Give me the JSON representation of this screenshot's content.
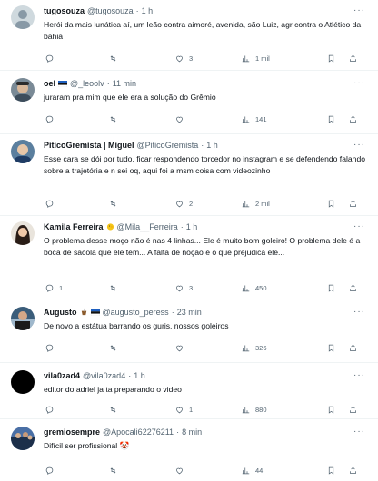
{
  "tweets": [
    {
      "name": "tugosouza",
      "handle": "@tugosouza",
      "time": "1 h",
      "text": "Herói da mais lunática aí, um leão contra aimoré, avenida, são Luiz, agr contra o Atlético da bahia",
      "replies": "",
      "retweets": "",
      "likes": "3",
      "views": "1 mil"
    },
    {
      "name": "oel",
      "handle": "@_leoolv",
      "time": "11 min",
      "text": "juraram pra mim que ele era a solução do Grêmio",
      "replies": "",
      "retweets": "",
      "likes": "",
      "views": "141"
    },
    {
      "name": "PiticoGremista | Miguel",
      "handle": "@PiticoGremista",
      "time": "1 h",
      "text": "Esse cara se dói por tudo, ficar respondendo torcedor no instagram e se defendendo falando sobre a trajetória e n sei oq, aqui foi a msm coisa com videozinho",
      "replies": "",
      "retweets": "",
      "likes": "2",
      "views": "2 mil"
    },
    {
      "name": "Kamila Ferreira",
      "handle": "@Mila__Ferreira",
      "time": "1 h",
      "text": "O problema desse moço não é nas 4 linhas... Ele é muito bom goleiro! O problema dele é a boca de sacola que ele tem... A falta de noção é o que prejudica ele...",
      "replies": "1",
      "retweets": "",
      "likes": "3",
      "views": "450"
    },
    {
      "name": "Augusto",
      "handle": "@augusto_peress",
      "time": "23 min",
      "text": "De novo a estátua barrando os guris, nossos goleiros",
      "replies": "",
      "retweets": "",
      "likes": "",
      "views": "326"
    },
    {
      "name": "vila0zad4",
      "handle": "@vila0zad4",
      "time": "1 h",
      "text": "editor do adriel ja ta preparando o video",
      "replies": "",
      "retweets": "",
      "likes": "1",
      "views": "880"
    },
    {
      "name": "gremiosempre",
      "handle": "@Apocali62276211",
      "time": "8 min",
      "text": "Difícil ser profissional 🤡",
      "replies": "",
      "retweets": "",
      "likes": "",
      "views": "44"
    }
  ],
  "icons": {
    "more": "more-icon",
    "reply": "reply-icon",
    "retweet": "retweet-icon",
    "like": "like-icon",
    "views": "views-icon",
    "bookmark": "bookmark-icon",
    "share": "share-icon"
  },
  "colors": {
    "text": "#0f1419",
    "secondary": "#536471",
    "border": "#eff3f4",
    "chick_badge": "#f5c518"
  }
}
